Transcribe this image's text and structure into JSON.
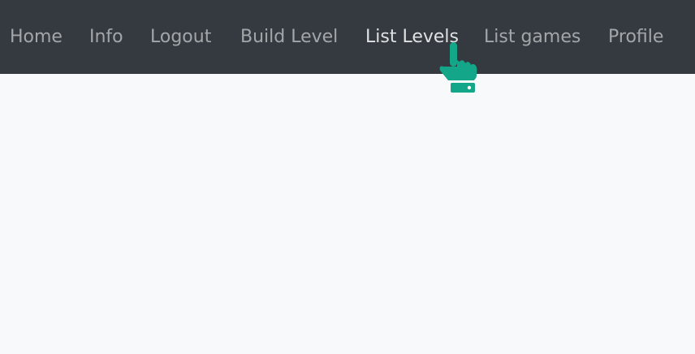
{
  "navbar": {
    "items": [
      {
        "label": "Home"
      },
      {
        "label": "Info"
      },
      {
        "label": "Logout"
      },
      {
        "label": "Build Level"
      },
      {
        "label": "List Levels"
      },
      {
        "label": "List games"
      },
      {
        "label": "Profile"
      }
    ],
    "hovered_label": "List Levels",
    "background_color": "#343a40",
    "text_color": "#9fa3a7",
    "hover_text_color": "#dcdde0"
  },
  "cursor": {
    "icon": "pointing-hand-cursor-icon",
    "color": "#13a688"
  },
  "page": {
    "background_color": "#f8f9fa"
  }
}
